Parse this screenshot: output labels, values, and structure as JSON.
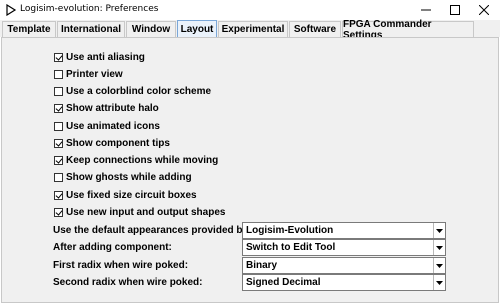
{
  "window": {
    "title": "Logisim-evolution: Preferences"
  },
  "tabs": [
    {
      "label": "Template"
    },
    {
      "label": "International"
    },
    {
      "label": "Window"
    },
    {
      "label": "Layout",
      "active": true
    },
    {
      "label": "Experimental"
    },
    {
      "label": "Software"
    },
    {
      "label": "FPGA Commander Settings"
    }
  ],
  "options": [
    {
      "label": "Use anti aliasing",
      "checked": true
    },
    {
      "label": "Printer view",
      "checked": false
    },
    {
      "label": "Use a colorblind color scheme",
      "checked": false
    },
    {
      "label": "Show attribute halo",
      "checked": true
    },
    {
      "label": "Use animated icons",
      "checked": false
    },
    {
      "label": "Show component tips",
      "checked": true
    },
    {
      "label": "Keep connections while moving",
      "checked": true
    },
    {
      "label": "Show ghosts while adding",
      "checked": false
    },
    {
      "label": "Use fixed size circuit boxes",
      "checked": true
    },
    {
      "label": "Use new input and output shapes",
      "checked": true
    }
  ],
  "settings": [
    {
      "label": "Use the default appearances provided by:",
      "value": "Logisim-Evolution"
    },
    {
      "label": "After adding component:",
      "value": "Switch to Edit Tool"
    },
    {
      "label": "First radix when wire poked:",
      "value": "Binary"
    },
    {
      "label": "Second radix when wire poked:",
      "value": "Signed Decimal"
    }
  ],
  "colors": {
    "active_tab_bg": "#eaf2fb",
    "active_tab_border": "#7aa7d8",
    "panel_bg": "#f0f0f0"
  }
}
